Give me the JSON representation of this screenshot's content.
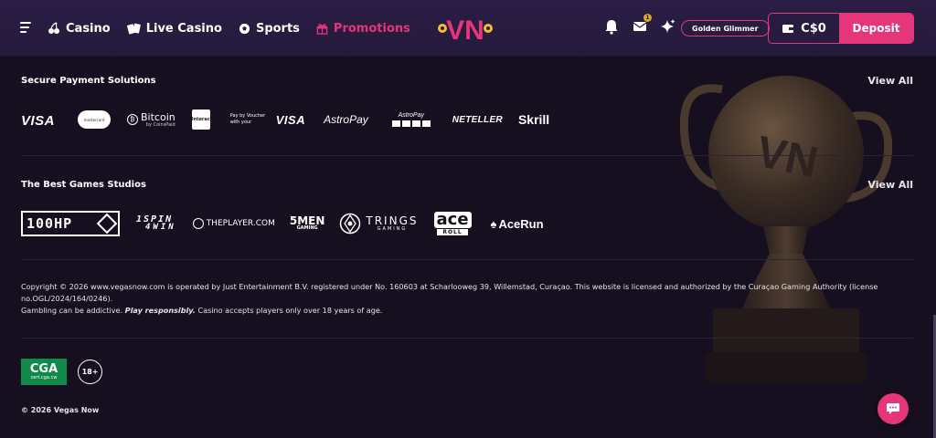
{
  "colors": {
    "accent": "#e5357b",
    "header_bg": "#2b1d45",
    "page_bg": "#150f1f",
    "cga_green": "#108a4a"
  },
  "header": {
    "nav": [
      {
        "label": "Casino",
        "icon": "cherries-icon"
      },
      {
        "label": "Live Casino",
        "icon": "cards-icon"
      },
      {
        "label": "Sports",
        "icon": "soccer-ball-icon"
      },
      {
        "label": "Promotions",
        "icon": "gift-icon"
      }
    ],
    "logo_text": "VN",
    "mail_count": "1",
    "level_label": "Golden Glimmer",
    "balance": "C$0",
    "deposit_label": "Deposit"
  },
  "payments": {
    "title": "Secure Payment Solutions",
    "view_all": "View All",
    "logos": {
      "visa": "VISA",
      "mastercard": "mastercard",
      "bitcoin": "Bitcoin",
      "bitcoin_sub": "by CoinsPaid",
      "interac": "Interac",
      "voucher_small": "Pay by Voucher with your",
      "voucher_visa": "VISA",
      "astropay": "AstroPay",
      "astropay_cards": "AstroPay",
      "neteller": "NETELLER",
      "skrill": "Skrill"
    }
  },
  "studios": {
    "title": "The Best Games Studios",
    "view_all": "View All",
    "logos": {
      "hp": "100HP",
      "spin_top": "1SPIN",
      "spin_bottom": "4WIN",
      "player": "THEPLAYER.COM",
      "fivemen": "5MEN",
      "fivemen_sub": "GAMING",
      "trings": "TRINGS",
      "trings_sub": "GAMING",
      "ace": "ace",
      "ace_sub": "ROLL",
      "acerun": "AceRun"
    }
  },
  "legal": {
    "line1": "Copyright © 2026 www.vegasnow.com is operated by Just Entertainment B.V. registered under No. 160603 at Scharlooweg 39, Willemstad, Curaçao. This website is licensed and authorized by the Curaçao Gaming Authority (license no.OGL/2024/164/0246).",
    "line2a": "Gambling can be addictive.",
    "line2b": "Play responsibly.",
    "line2c": "Casino accepts players only over 18 years of age."
  },
  "badges": {
    "cga": "CGA",
    "cga_sub": "cert.cga.cw",
    "age": "18+"
  },
  "footer": {
    "copyright": "© 2026 Vegas Now"
  }
}
